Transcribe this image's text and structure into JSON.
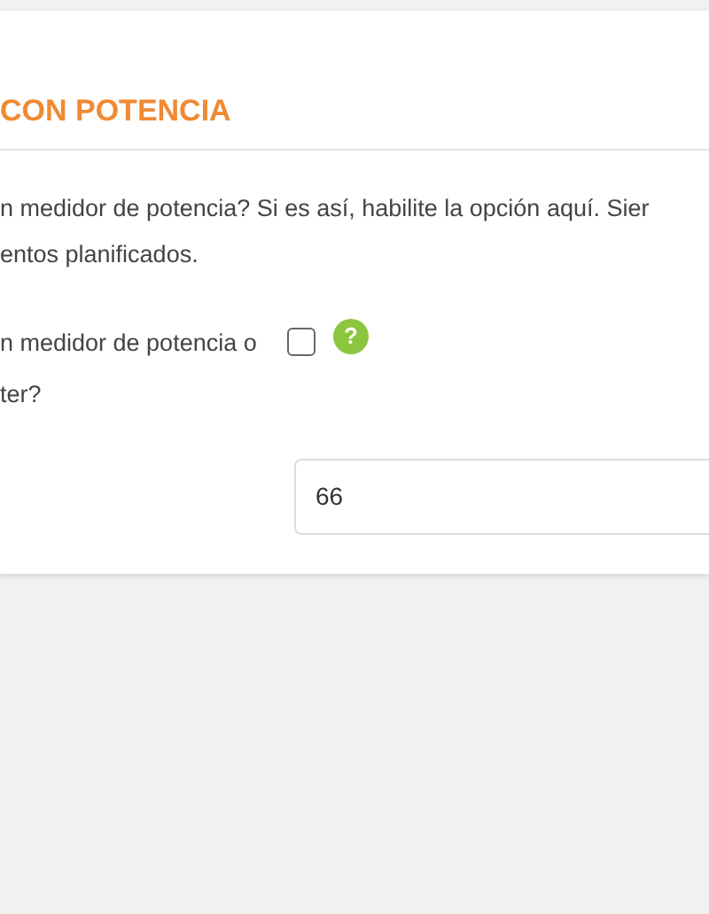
{
  "section": {
    "title": "CON POTENCIA",
    "description_lines": [
      "n medidor de potencia? Si es así, habilite la opción aquí. Sier",
      "entos planificados."
    ],
    "option": {
      "label_lines": [
        "n medidor de potencia o",
        "ter?"
      ],
      "checked": false,
      "help": "?"
    },
    "field": {
      "value": "66"
    }
  }
}
